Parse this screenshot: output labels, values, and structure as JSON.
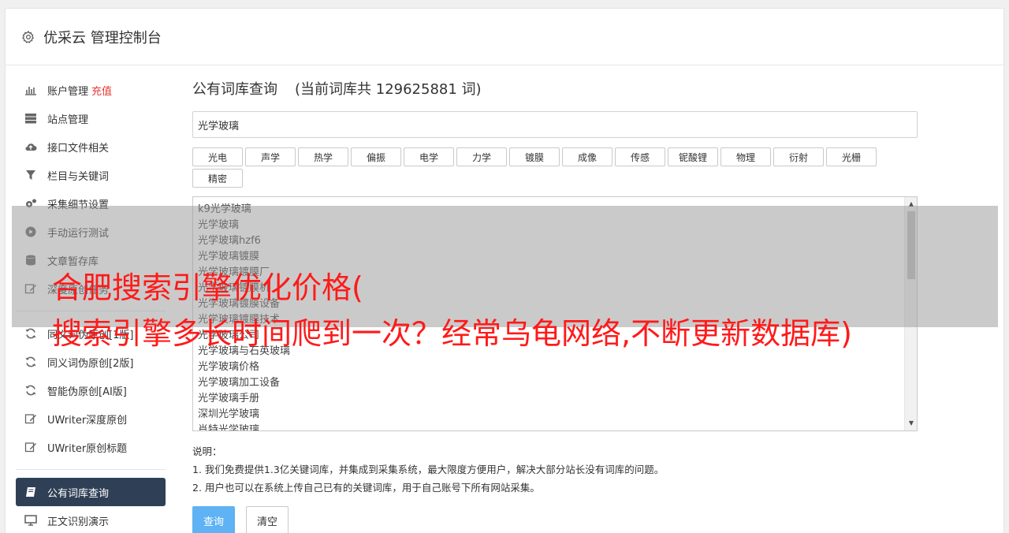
{
  "header": {
    "title": "优采云 管理控制台",
    "icon": "gear-icon"
  },
  "sidebar": {
    "items": [
      {
        "label": "账户管理",
        "extra": "充值",
        "icon": "bar-chart-icon"
      },
      {
        "label": "站点管理",
        "icon": "server-icon"
      },
      {
        "label": "接口文件相关",
        "icon": "cloud-upload-icon"
      },
      {
        "label": "栏目与关键词",
        "icon": "filter-icon"
      },
      {
        "label": "采集细节设置",
        "icon": "cogs-icon"
      },
      {
        "label": "手动运行测试",
        "icon": "play-circle-icon"
      },
      {
        "label": "文章暂存库",
        "icon": "database-icon"
      },
      {
        "label": "深度原创任务",
        "icon": "edit-icon"
      },
      {
        "label": "同义词伪原创[1版]",
        "icon": "refresh-icon"
      },
      {
        "label": "同义词伪原创[2版]",
        "icon": "refresh-icon"
      },
      {
        "label": "智能伪原创[AI版]",
        "icon": "refresh-icon"
      },
      {
        "label": "UWriter深度原创",
        "icon": "edit-icon"
      },
      {
        "label": "UWriter原创标题",
        "icon": "edit-icon"
      },
      {
        "label": "公有词库查询",
        "icon": "book-icon"
      },
      {
        "label": "正文识别演示",
        "icon": "monitor-icon"
      }
    ]
  },
  "main": {
    "title": "公有词库查询",
    "count_text": "(当前词库共 129625881 词)",
    "input_value": "光学玻璃",
    "tags": [
      "光电",
      "声学",
      "热学",
      "偏振",
      "电学",
      "力学",
      "镀膜",
      "成像",
      "传感",
      "铌酸锂",
      "物理",
      "衍射",
      "光栅",
      "精密"
    ],
    "results": [
      "k9光学玻璃",
      "光学玻璃",
      "光学玻璃hzf6",
      "光学玻璃镀膜",
      "光学玻璃镀膜厂",
      "光学玻璃镀膜机",
      "光学玻璃镀膜设备",
      "光学玻璃镀膜技术",
      "光学玻璃公司",
      "光学玻璃与石英玻璃",
      "光学玻璃价格",
      "光学玻璃加工设备",
      "光学玻璃手册",
      "深圳光学玻璃",
      "肖特光学玻璃"
    ],
    "notes_title": "说明：",
    "notes": [
      "1. 我们免费提供1.3亿关键词库，并集成到采集系统，最大限度方便用户，解决大部分站长没有词库的问题。",
      "2. 用户也可以在系统上传自己已有的关键词库，用于自己账号下所有网站采集。"
    ],
    "query_button": "查询",
    "clear_button": "清空"
  },
  "overlay": {
    "line1": "合肥搜索引擎优化价格(",
    "line2": "搜索引擎多长时间爬到一次？经常乌龟网络,不断更新数据库)"
  },
  "colors": {
    "active_nav": "#2f4056",
    "primary_button": "#5fb2f3",
    "recharge": "#e53935",
    "overlay_text": "#ff1a1a"
  }
}
